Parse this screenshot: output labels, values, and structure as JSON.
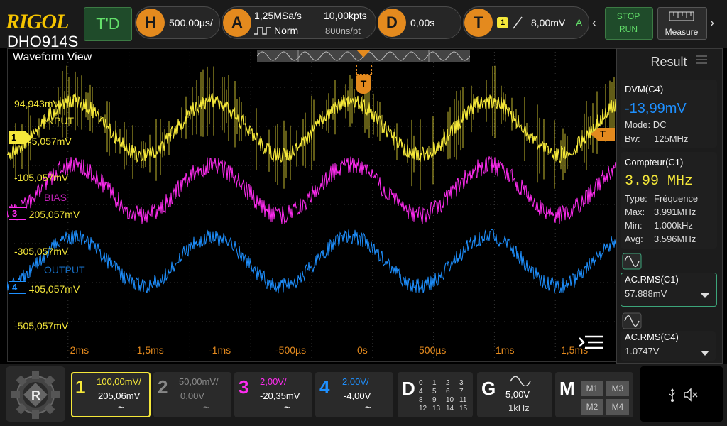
{
  "brand": {
    "logo": "RIGOL",
    "model": "DHO914S"
  },
  "topbar": {
    "trigger_delay_label": "T'D",
    "horizontal": {
      "badge": "H",
      "value": "500,00µs/"
    },
    "acquire": {
      "badge": "A",
      "rate": "1,25MSa/s",
      "mode": "Norm",
      "points": "10,00kpts",
      "per_point": "800ns/pt"
    },
    "delay": {
      "badge": "D",
      "value": "0,00s"
    },
    "trigger": {
      "badge": "T",
      "source": "1",
      "level": "8,00mV",
      "mode_letter": "A"
    },
    "stop_run": {
      "stop": "STOP",
      "run": "RUN"
    },
    "measure_label": "Measure"
  },
  "wave": {
    "title": "Waveform View",
    "trigger_marker": "T",
    "ch1_offset": "94,943mV",
    "ch1_label": "INPUT",
    "ch1_level": "-5,057mV",
    "ch1_level2": "-105,057mV",
    "ch3_label": "BIAS",
    "ch3_level": "-205,057mV",
    "ch3_level2": "-305,057mV",
    "ch4_label": "OUTPUT",
    "ch4_level": "-405,057mV",
    "ch4_level2": "-505,057mV",
    "channel_markers": [
      "1",
      "3",
      "4"
    ],
    "x_ticks": [
      "-2ms",
      "-1,5ms",
      "-1ms",
      "-500µs",
      "0s",
      "500µs",
      "1ms",
      "1,5ms"
    ]
  },
  "result": {
    "title": "Result",
    "dvm": {
      "title": "DVM(C4)",
      "value": "-13,99mV",
      "mode": "Mode: DC",
      "bw_label": "Bw:",
      "bw_value": "125MHz"
    },
    "counter": {
      "title": "Compteur(C1)",
      "value": "3.99 MHz",
      "rows": [
        {
          "k": "Type:",
          "v": "Fréquence"
        },
        {
          "k": "Max:",
          "v": "3.991MHz"
        },
        {
          "k": "Min:",
          "v": "1.000kHz"
        },
        {
          "k": "Avg:",
          "v": "3.596MHz"
        }
      ]
    },
    "acrms1": {
      "title": "AC.RMS(C1)",
      "value": "57.888mV"
    },
    "acrms4": {
      "title": "AC.RMS(C4)",
      "value": "1.0747V"
    }
  },
  "bottom": {
    "ch1": {
      "num": "1",
      "scale": "100,00mV/",
      "offset": "205,06mV",
      "coupling": "~"
    },
    "ch2": {
      "num": "2",
      "scale": "50,00mV/",
      "offset": "0,00V",
      "coupling": "~"
    },
    "ch3": {
      "num": "3",
      "scale": "2,00V/",
      "offset": "-20,35mV",
      "coupling": "~"
    },
    "ch4": {
      "num": "4",
      "scale": "2,00V/",
      "offset": "-4,00V",
      "coupling": "~"
    },
    "digital": {
      "badge": "D",
      "bits": [
        "0",
        "1",
        "2",
        "3",
        "4",
        "5",
        "6",
        "7",
        "8",
        "9",
        "10",
        "11",
        "12",
        "13",
        "14",
        "15"
      ]
    },
    "gen": {
      "badge": "G",
      "amp": "5,00V",
      "freq": "1kHz"
    },
    "math": {
      "badge": "M",
      "items": [
        "M1",
        "M3",
        "M2",
        "M4"
      ]
    }
  },
  "colors": {
    "ch1": "#f5e83a",
    "ch2": "#888888",
    "ch3": "#ff2cf0",
    "ch4": "#1e90ff",
    "accent": "#e48a1e"
  }
}
